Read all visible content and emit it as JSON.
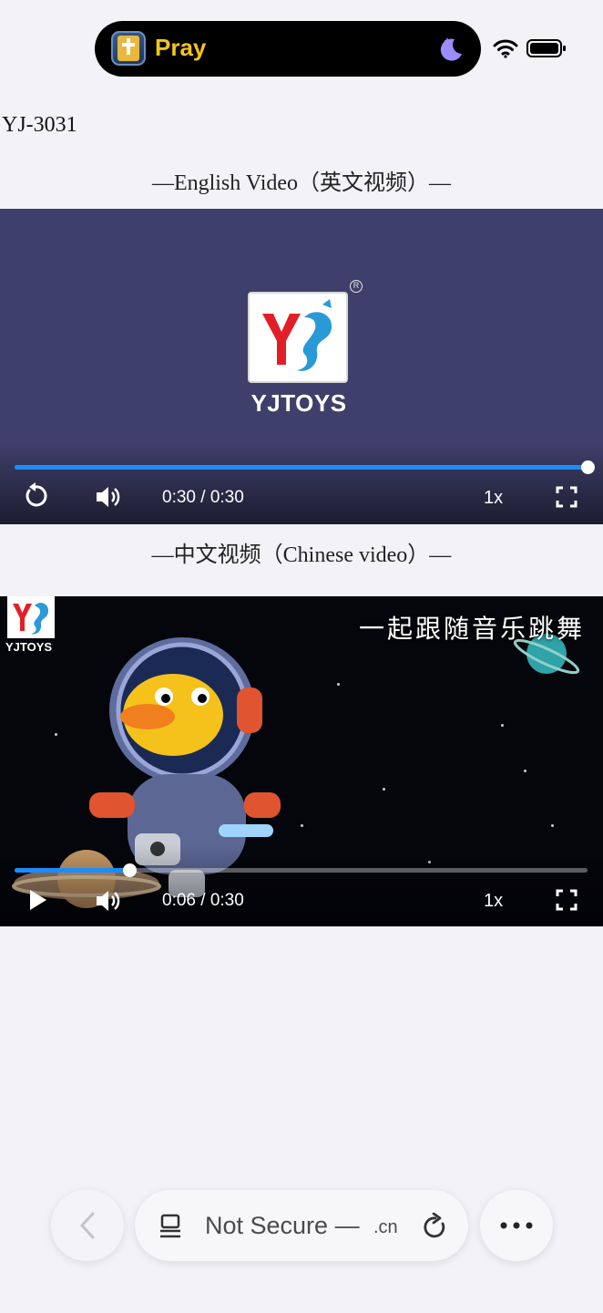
{
  "status_bar": {
    "app_label": "Pray"
  },
  "page": {
    "product_code": "YJ-3031",
    "english_title": "—English Video（英文视频）—",
    "chinese_title": "—中文视频（Chinese video）—"
  },
  "video_english": {
    "logo_text": "YJTOYS",
    "logo_registered": "R",
    "time": "0:30 / 0:30",
    "speed": "1x",
    "progress": 1.0
  },
  "video_chinese": {
    "brand_text": "YJTOYS",
    "caption": "一起跟随音乐跳舞",
    "time": "0:06 / 0:30",
    "speed": "1x",
    "progress": 0.2
  },
  "browser": {
    "url_label": "Not Secure —",
    "url_domain": ".cn"
  },
  "colors": {
    "accent_progress": "#1a8cff",
    "pray_label": "#f5c518",
    "english_video_bg": "#3f3f6b"
  }
}
